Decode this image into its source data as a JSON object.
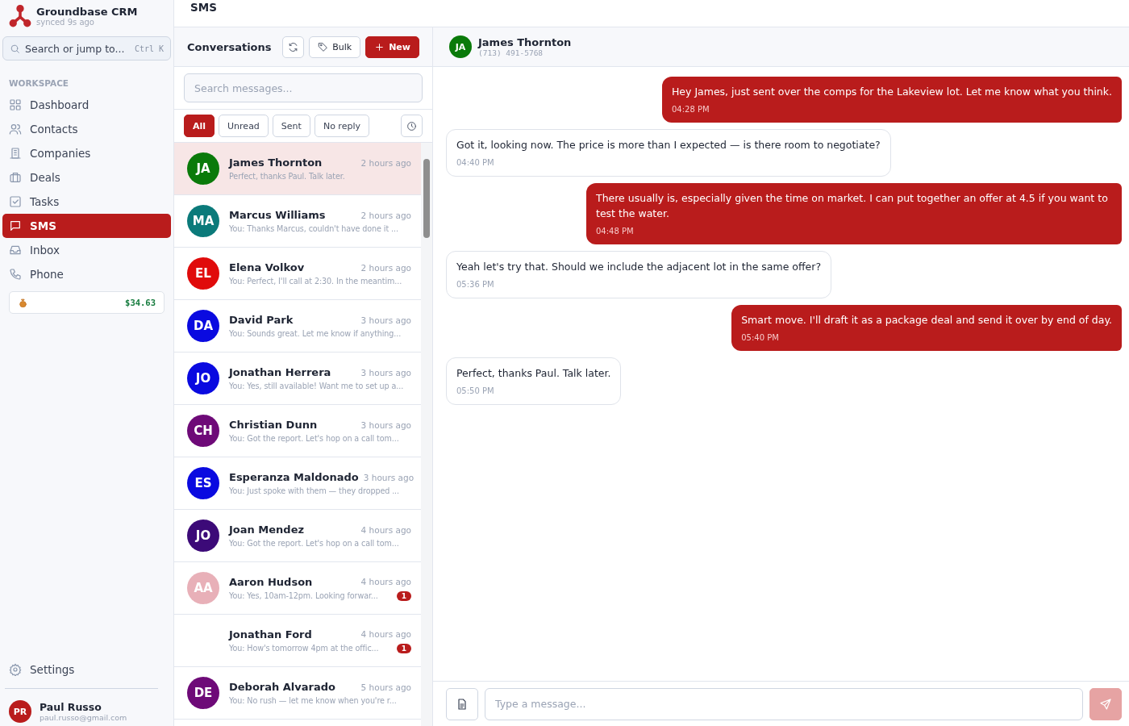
{
  "app": {
    "name": "Groundbase CRM",
    "sync": "synced 9s ago"
  },
  "search": {
    "placeholder": "Search or jump to...",
    "shortcut": "Ctrl K"
  },
  "section": "WORKSPACE",
  "nav": [
    {
      "label": "Dashboard",
      "selected": false
    },
    {
      "label": "Contacts",
      "selected": false
    },
    {
      "label": "Companies",
      "selected": false
    },
    {
      "label": "Deals",
      "selected": false
    },
    {
      "label": "Tasks",
      "selected": false
    },
    {
      "label": "SMS",
      "selected": true
    },
    {
      "label": "Inbox",
      "selected": false
    },
    {
      "label": "Phone",
      "selected": false
    }
  ],
  "balance": "$34.63",
  "settings": "Settings",
  "user": {
    "initials": "PR",
    "name": "Paul Russo",
    "email": "paul.russo@gmail.com"
  },
  "page_title": "SMS",
  "conversations": {
    "title": "Conversations",
    "bulk": "Bulk",
    "new": "New",
    "search_placeholder": "Search messages...",
    "filters": [
      {
        "label": "All",
        "selected": true
      },
      {
        "label": "Unread",
        "selected": false
      },
      {
        "label": "Sent",
        "selected": false
      },
      {
        "label": "No reply",
        "selected": false
      }
    ],
    "items": [
      {
        "initials": "JA",
        "color": "#0a7a0a",
        "name": "James Thornton",
        "time": "2 hours ago",
        "preview": "Perfect, thanks Paul. Talk later.",
        "selected": true
      },
      {
        "initials": "MA",
        "color": "#0b7a7a",
        "name": "Marcus Williams",
        "time": "2 hours ago",
        "preview": "You: Thanks Marcus, couldn't have done it ...",
        "selected": false
      },
      {
        "initials": "EL",
        "color": "#e00b0b",
        "name": "Elena Volkov",
        "time": "2 hours ago",
        "preview": "You: Perfect, I'll call at 2:30. In the meantim...",
        "selected": false
      },
      {
        "initials": "DA",
        "color": "#0a0ae0",
        "name": "David Park",
        "time": "3 hours ago",
        "preview": "You: Sounds great. Let me know if anything...",
        "selected": false
      },
      {
        "initials": "JO",
        "color": "#0a0ae0",
        "name": "Jonathan Herrera",
        "time": "3 hours ago",
        "preview": "You: Yes, still available! Want me to set up a...",
        "selected": false
      },
      {
        "initials": "CH",
        "color": "#6e0a78",
        "name": "Christian Dunn",
        "time": "3 hours ago",
        "preview": "You: Got the report. Let's hop on a call tom...",
        "selected": false
      },
      {
        "initials": "ES",
        "color": "#0a0ae0",
        "name": "Esperanza Maldonado",
        "time": "3 hours ago",
        "preview": "You: Just spoke with them — they dropped ...",
        "selected": false
      },
      {
        "initials": "JO",
        "color": "#3c0a78",
        "name": "Joan Mendez",
        "time": "4 hours ago",
        "preview": "You: Got the report. Let's hop on a call tom...",
        "selected": false
      },
      {
        "initials": "AA",
        "color": "#e8b0b8",
        "name": "Aaron Hudson",
        "time": "4 hours ago",
        "preview": "You: Yes, 10am-12pm. Looking forwar...",
        "unread": "1",
        "selected": false
      },
      {
        "name": "Jonathan Ford",
        "time": "4 hours ago",
        "preview": "You: How's tomorrow 4pm at the offic...",
        "unread": "1",
        "selected": false
      },
      {
        "initials": "DE",
        "color": "#6e0a78",
        "name": "Deborah Alvarado",
        "time": "5 hours ago",
        "preview": "You: No rush — let me know when you're r...",
        "selected": false
      }
    ]
  },
  "chat": {
    "initials": "JA",
    "color": "#0a7a0a",
    "name": "James Thornton",
    "phone": "(713) 491-5768",
    "messages": [
      {
        "kind": "out",
        "text": "Hey James, just sent over the comps for the Lakeview lot. Let me know what you think.",
        "time": "04:28 PM"
      },
      {
        "kind": "in",
        "text": "Got it, looking now. The price is more than I expected — is there room to negotiate?",
        "time": "04:40 PM"
      },
      {
        "kind": "out",
        "text": "There usually is, especially given the time on market. I can put together an offer at 4.5 if you want to test the water.",
        "time": "04:48 PM"
      },
      {
        "kind": "in",
        "text": "Yeah let's try that. Should we include the adjacent lot in the same offer?",
        "time": "05:36 PM"
      },
      {
        "kind": "out",
        "text": "Smart move. I'll draft it as a package deal and send it over by end of day.",
        "time": "05:40 PM"
      },
      {
        "kind": "in",
        "text": "Perfect, thanks Paul. Talk later.",
        "time": "05:50 PM"
      }
    ],
    "placeholder": "Type a message..."
  }
}
